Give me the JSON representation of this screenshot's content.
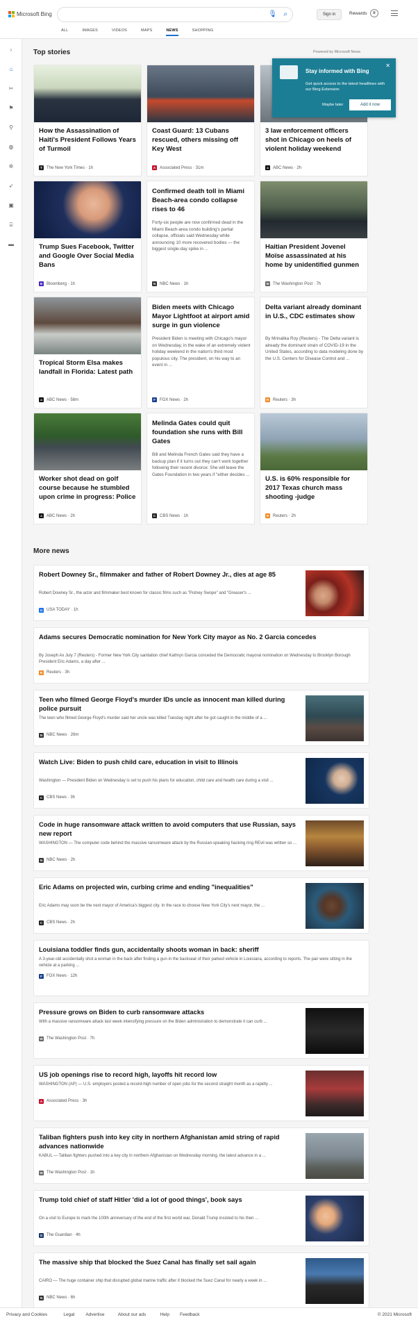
{
  "header": {
    "brand": "Microsoft Bing",
    "sign_in": "Sign in",
    "rewards": "Rewards"
  },
  "tabs": [
    "ALL",
    "IMAGES",
    "VIDEOS",
    "MAPS",
    "NEWS",
    "SHOPPING"
  ],
  "top_stories": {
    "heading": "Top stories",
    "powered": "Powered by Microsoft News"
  },
  "promo": {
    "title": "Stay informed with Bing",
    "desc": "Get quick access to the latest headlines with our Bing Extension",
    "later": "Maybe later",
    "add": "Add it now"
  },
  "cards": [
    {
      "title": "How the Assassination of Haiti's President Follows Years of Turmoil",
      "src": "The New York Times · 1h",
      "logo": "T",
      "lc": "#222"
    },
    {
      "title": "Coast Guard: 13 Cubans rescued, others missing off Key West",
      "src": "Associated Press · 31m",
      "logo": "AP",
      "lc": "#c8102e"
    },
    {
      "title": "3 law enforcement officers shot in Chicago on heels of violent holiday weekend",
      "src": "ABC News · 2h",
      "logo": "abc",
      "lc": "#111"
    },
    {
      "title": "Trump Sues Facebook, Twitter and Google Over Social Media Bans",
      "src": "Bloomberg · 1h",
      "logo": "B",
      "lc": "#4627c4"
    },
    {
      "title": "Confirmed death toll in Miami Beach-area condo collapse rises to 46",
      "desc": "Forty-six people are now confirmed dead in the Miami Beach-area condo building's partial collapse, officials said Wednesday while announcing 10 more recovered bodies — the biggest single-day spike in ...",
      "src": "NBC News · 1h",
      "logo": "N",
      "lc": "#333"
    },
    {
      "title": "Haitian President Jovenel Moïse assassinated at his home by unidentified gunmen",
      "src": "The Washington Post · 7h",
      "logo": "W",
      "lc": "#666"
    },
    {
      "title": "Tropical Storm Elsa makes landfall in Florida: Latest path",
      "src": "ABC News · 58m",
      "logo": "abc",
      "lc": "#111"
    },
    {
      "title": "Biden meets with Chicago Mayor Lightfoot at airport amid surge in gun violence",
      "desc": "President Biden is meeting with Chicago's mayor on Wednesday, in the wake of an extremely violent holiday weekend in the nation's third most populous city. The president, on his way to an event in ...",
      "src": "FOX News · 2h",
      "logo": "F",
      "lc": "#1a3f8f"
    },
    {
      "title": "Delta variant already dominant in U.S., CDC estimates show",
      "desc": "By Mrinalika Roy (Reuters) - The Delta variant is already the dominant strain of COVID-19 in the United States, according to data modeling done by the U.S. Centers for Disease Control and ...",
      "src": "Reuters · 3h",
      "logo": "R",
      "lc": "#f28c28"
    },
    {
      "title": "Worker shot dead on golf course because he stumbled upon crime in progress: Police",
      "src": "ABC News · 2h",
      "logo": "abc",
      "lc": "#111"
    },
    {
      "title": "Melinda Gates could quit foundation she runs with Bill Gates",
      "desc": "Bill and Melinda French Gates said they have a backup plan if it turns out they can't work together following their recent divorce: She will leave the Gates Foundation in two years if \"either decides ...",
      "src": "CBS News · 1h",
      "logo": "C",
      "lc": "#222"
    },
    {
      "title": "U.S. is 60% responsible for 2017 Texas church mass shooting -judge",
      "src": "Reuters · 2h",
      "logo": "R",
      "lc": "#f28c28"
    }
  ],
  "more_news": {
    "heading": "More news",
    "items": [
      {
        "title": "Robert Downey Sr., filmmaker and father of Robert Downey Jr., dies at age 85",
        "desc": "Robert Downey Sr., the actor and filmmaker best known for classic films such as \"Putney Swope\" and \"Greaser's ...",
        "src": "USA TODAY · 1h",
        "logo": "U",
        "lc": "#1a73e8"
      },
      {
        "title": "Adams secures Democratic nomination for New York City mayor as No. 2 Garcia concedes",
        "desc": "By Joseph Ax July 7 (Reuters) - Former New York City sanitation chief Kathryn Garcia conceded the Democratic mayoral nomination on Wednesday to Brooklyn Borough President Eric Adams, a day after ...",
        "src": "Reuters · 3h",
        "logo": "R",
        "lc": "#f28c28"
      },
      {
        "title": "Teen who filmed George Floyd's murder IDs uncle as innocent man killed during police pursuit",
        "desc": "The teen who filmed George Floyd's murder said her uncle was killed Tuesday night after he got caught in the middle of a ...",
        "src": "NBC News · 26m",
        "logo": "N",
        "lc": "#333"
      },
      {
        "title": "Watch Live: Biden to push child care, education in visit to Illinois",
        "desc": "Washington — President Biden on Wednesday is set to push his plans for education, child care and health care during a visit ...",
        "src": "CBS News · 3h",
        "logo": "C",
        "lc": "#222"
      },
      {
        "title": "Code in huge ransomware attack written to avoid computers that use Russian, says new report",
        "desc": "WASHINGTON — The computer code behind the massive ransomware attack by the Russian-speaking hacking ring REvil was written so ...",
        "src": "NBC News · 2h",
        "logo": "N",
        "lc": "#333"
      },
      {
        "title": "Eric Adams on projected win, curbing crime and ending \"inequalities\"",
        "desc": "Eric Adams may soon be the next mayor of America's biggest city. In the race to choose New York City's next mayor, the ...",
        "src": "CBS News · 2h",
        "logo": "C",
        "lc": "#222"
      },
      {
        "title": "Louisiana toddler finds gun, accidentally shoots woman in back: sheriff",
        "desc": "A 3-year-old accidentally shot a woman in the back after finding a gun in the backseat of their parked vehicle in Louisiana, according to reports. The pair were sitting in the vehicle at a parking ...",
        "src": "FOX News · 12h",
        "logo": "F",
        "lc": "#1a3f8f"
      },
      {
        "title": "Pressure grows on Biden to curb ransomware attacks",
        "desc": "With a massive ransomware attack last week intensifying pressure on the Biden administration to demonstrate it can curb ...",
        "src": "The Washington Post · 7h",
        "logo": "W",
        "lc": "#666"
      },
      {
        "title": "US job openings rise to record high, layoffs hit record low",
        "desc": "WASHINGTON (AP) — U.S. employers posted a record-high number of open jobs for the second straight month as a rapidly ...",
        "src": "Associated Press · 3h",
        "logo": "AP",
        "lc": "#c8102e"
      },
      {
        "title": "Taliban fighters push into key city in northern Afghanistan amid string of rapid advances nationwide",
        "desc": "KABUL — Taliban fighters pushed into a key city in northern Afghanistan on Wednesday morning, the latest advance in a ...",
        "src": "The Washington Post · 1h",
        "logo": "W",
        "lc": "#666"
      },
      {
        "title": "Trump told chief of staff Hitler 'did a lot of good things', book says",
        "desc": "On a visit to Europe to mark the 100th anniversary of the end of the first world war, Donald Trump insisted to his then ...",
        "src": "The Guardian · 4h",
        "logo": "G",
        "lc": "#1a3a6b"
      },
      {
        "title": "The massive ship that blocked the Suez Canal has finally set sail again",
        "desc": "CAIRO — The huge container ship that disrupted global marine traffic after it blocked the Suez Canal for nearly a week in ...",
        "src": "NBC News · 6h",
        "logo": "N",
        "lc": "#333"
      }
    ]
  },
  "footer": {
    "links": [
      "Privacy and Cookies",
      "Legal",
      "Advertise",
      "About our ads",
      "Help",
      "Feedback"
    ],
    "copy": "© 2021 Microsoft"
  }
}
